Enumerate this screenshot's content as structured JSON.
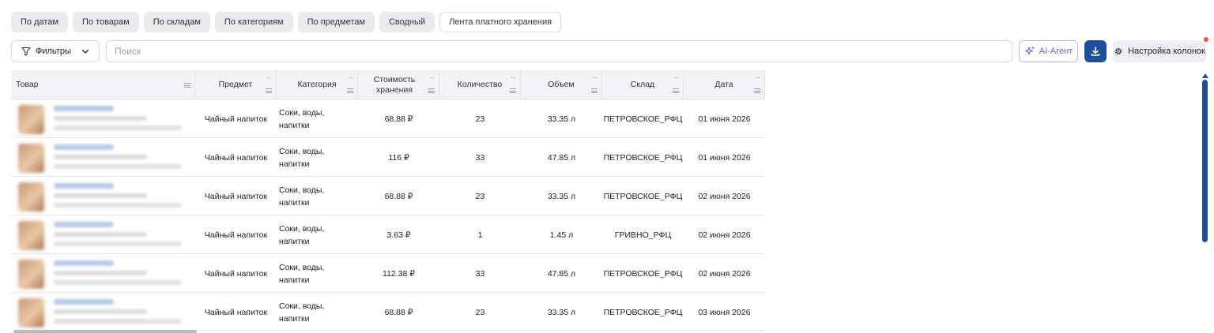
{
  "tabs": [
    {
      "label": "По датам",
      "active": false
    },
    {
      "label": "По товарам",
      "active": false
    },
    {
      "label": "По складам",
      "active": false
    },
    {
      "label": "По категориям",
      "active": false
    },
    {
      "label": "По предметам",
      "active": false
    },
    {
      "label": "Сводный",
      "active": false
    },
    {
      "label": "Лента платного хранения",
      "active": true
    }
  ],
  "toolbar": {
    "filters_label": "Фильтры",
    "search_placeholder": "Поиск",
    "search_value": "",
    "ai_label": "AI-Агент",
    "columns_label": "Настройка колонок"
  },
  "colors": {
    "accent": "#1f4e9c",
    "ai_purple": "#6b5fd3",
    "notification": "#e05757"
  },
  "table": {
    "columns": [
      "Товар",
      "Предмет",
      "Категория",
      "Стоимость хранения",
      "Количество",
      "Объем",
      "Склад",
      "Дата"
    ],
    "rows": [
      {
        "subject": "Чайный напиток",
        "category": "Соки, воды, напитки",
        "cost": "68.88 ₽",
        "qty": "23",
        "volume": "33.35 л",
        "warehouse": "ПЕТРОВСКОЕ_РФЦ",
        "date": "01 июня 2026"
      },
      {
        "subject": "Чайный напиток",
        "category": "Соки, воды, напитки",
        "cost": "116 ₽",
        "qty": "33",
        "volume": "47.85 л",
        "warehouse": "ПЕТРОВСКОЕ_РФЦ",
        "date": "01 июня 2026"
      },
      {
        "subject": "Чайный напиток",
        "category": "Соки, воды, напитки",
        "cost": "68.88 ₽",
        "qty": "23",
        "volume": "33.35 л",
        "warehouse": "ПЕТРОВСКОЕ_РФЦ",
        "date": "02 июня 2026"
      },
      {
        "subject": "Чайный напиток",
        "category": "Соки, воды, напитки",
        "cost": "3.63 ₽",
        "qty": "1",
        "volume": "1.45 л",
        "warehouse": "ГРИВНО_РФЦ",
        "date": "02 июня 2026"
      },
      {
        "subject": "Чайный напиток",
        "category": "Соки, воды, напитки",
        "cost": "112.38 ₽",
        "qty": "33",
        "volume": "47.85 л",
        "warehouse": "ПЕТРОВСКОЕ_РФЦ",
        "date": "02 июня 2026"
      },
      {
        "subject": "Чайный напиток",
        "category": "Соки, воды, напитки",
        "cost": "68.88 ₽",
        "qty": "23",
        "volume": "33.35 л",
        "warehouse": "ПЕТРОВСКОЕ_РФЦ",
        "date": "03 июня 2026"
      }
    ]
  }
}
